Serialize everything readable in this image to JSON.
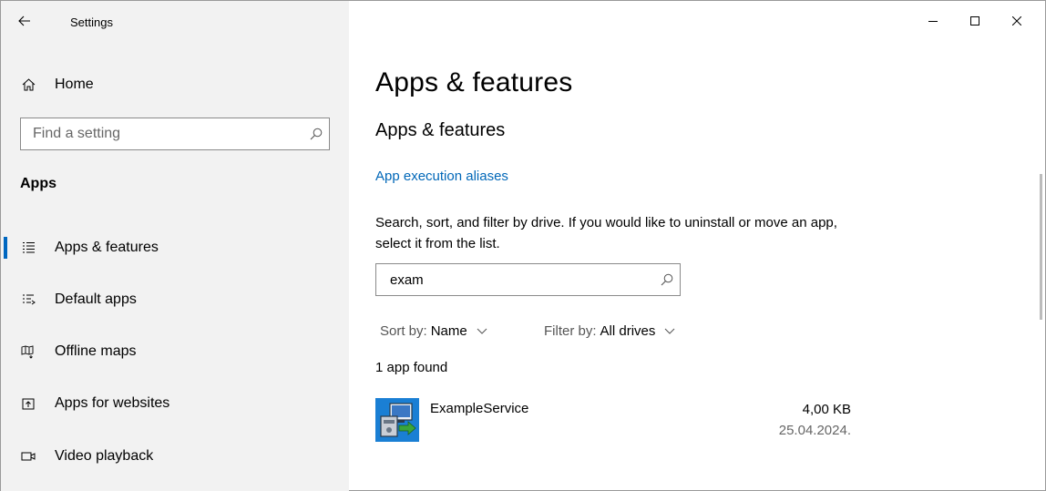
{
  "window": {
    "title": "Settings",
    "back_icon": "arrow-left-icon",
    "controls": [
      "minimize-icon",
      "maximize-icon",
      "close-icon"
    ]
  },
  "sidebar": {
    "home": {
      "label": "Home",
      "icon": "home-icon"
    },
    "search": {
      "placeholder": "Find a setting",
      "value": ""
    },
    "section_title": "Apps",
    "items": [
      {
        "label": "Apps & features",
        "icon": "list-icon",
        "active": true
      },
      {
        "label": "Default apps",
        "icon": "default-apps-icon",
        "active": false
      },
      {
        "label": "Offline maps",
        "icon": "map-icon",
        "active": false
      },
      {
        "label": "Apps for websites",
        "icon": "link-box-icon",
        "active": false
      },
      {
        "label": "Video playback",
        "icon": "video-icon",
        "active": false
      }
    ]
  },
  "main": {
    "heading": "Apps & features",
    "subheading": "Apps & features",
    "link": "App execution aliases",
    "description": "Search, sort, and filter by drive. If you would like to uninstall or move an app, select it from the list.",
    "search": {
      "value": "exam",
      "placeholder": ""
    },
    "sort": {
      "label": "Sort by:",
      "value": "Name"
    },
    "filter": {
      "label": "Filter by:",
      "value": "All drives"
    },
    "results_count": "1 app found",
    "apps": [
      {
        "name": "ExampleService",
        "size": "4,00 KB",
        "date": "25.04.2024.",
        "icon": "installer-icon"
      }
    ]
  },
  "colors": {
    "accent": "#0067c0",
    "link": "#0067b8",
    "sidebar_bg": "#f2f2f2"
  }
}
